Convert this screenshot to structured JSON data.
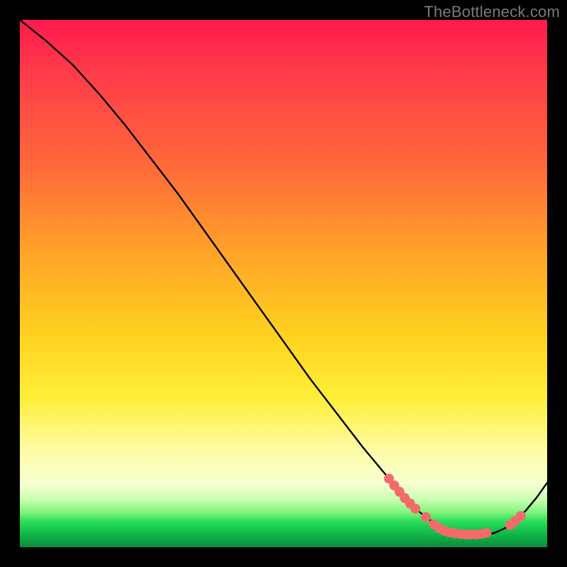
{
  "attribution": "TheBottleneck.com",
  "chart_data": {
    "type": "line",
    "title": "",
    "xlabel": "",
    "ylabel": "",
    "xlim": [
      0,
      100
    ],
    "ylim": [
      0,
      100
    ],
    "grid": false,
    "legend": false,
    "series": [
      {
        "name": "curve",
        "x": [
          0,
          5,
          10,
          15,
          20,
          25,
          30,
          35,
          40,
          45,
          50,
          55,
          60,
          65,
          70,
          72,
          74,
          76,
          78,
          80,
          82,
          84,
          86,
          88,
          90,
          92,
          94,
          96,
          98,
          100
        ],
        "y": [
          100,
          96,
          91.5,
          86,
          80,
          73.5,
          67,
          60,
          53,
          46,
          39,
          32,
          25.5,
          19,
          13,
          10.5,
          8.3,
          6.5,
          5.0,
          3.8,
          3.0,
          2.5,
          2.3,
          2.3,
          2.7,
          3.6,
          5.0,
          7.0,
          9.4,
          12.2
        ]
      }
    ],
    "markers": {
      "name": "highlighted-points",
      "color": "#f46a6a",
      "points": [
        {
          "x": 70.0,
          "y": 13.0
        },
        {
          "x": 71.0,
          "y": 11.7
        },
        {
          "x": 72.0,
          "y": 10.5
        },
        {
          "x": 73.0,
          "y": 9.3
        },
        {
          "x": 74.0,
          "y": 8.3
        },
        {
          "x": 75.0,
          "y": 7.3
        },
        {
          "x": 77.0,
          "y": 5.7
        },
        {
          "x": 78.5,
          "y": 4.3
        },
        {
          "x": 79.5,
          "y": 3.6
        },
        {
          "x": 80.5,
          "y": 3.1
        },
        {
          "x": 81.5,
          "y": 2.8
        },
        {
          "x": 82.5,
          "y": 2.6
        },
        {
          "x": 83.5,
          "y": 2.5
        },
        {
          "x": 84.5,
          "y": 2.4
        },
        {
          "x": 85.5,
          "y": 2.4
        },
        {
          "x": 86.5,
          "y": 2.4
        },
        {
          "x": 87.5,
          "y": 2.5
        },
        {
          "x": 88.5,
          "y": 2.7
        },
        {
          "x": 93.0,
          "y": 4.2
        },
        {
          "x": 94.0,
          "y": 5.0
        },
        {
          "x": 95.0,
          "y": 5.9
        }
      ]
    }
  }
}
